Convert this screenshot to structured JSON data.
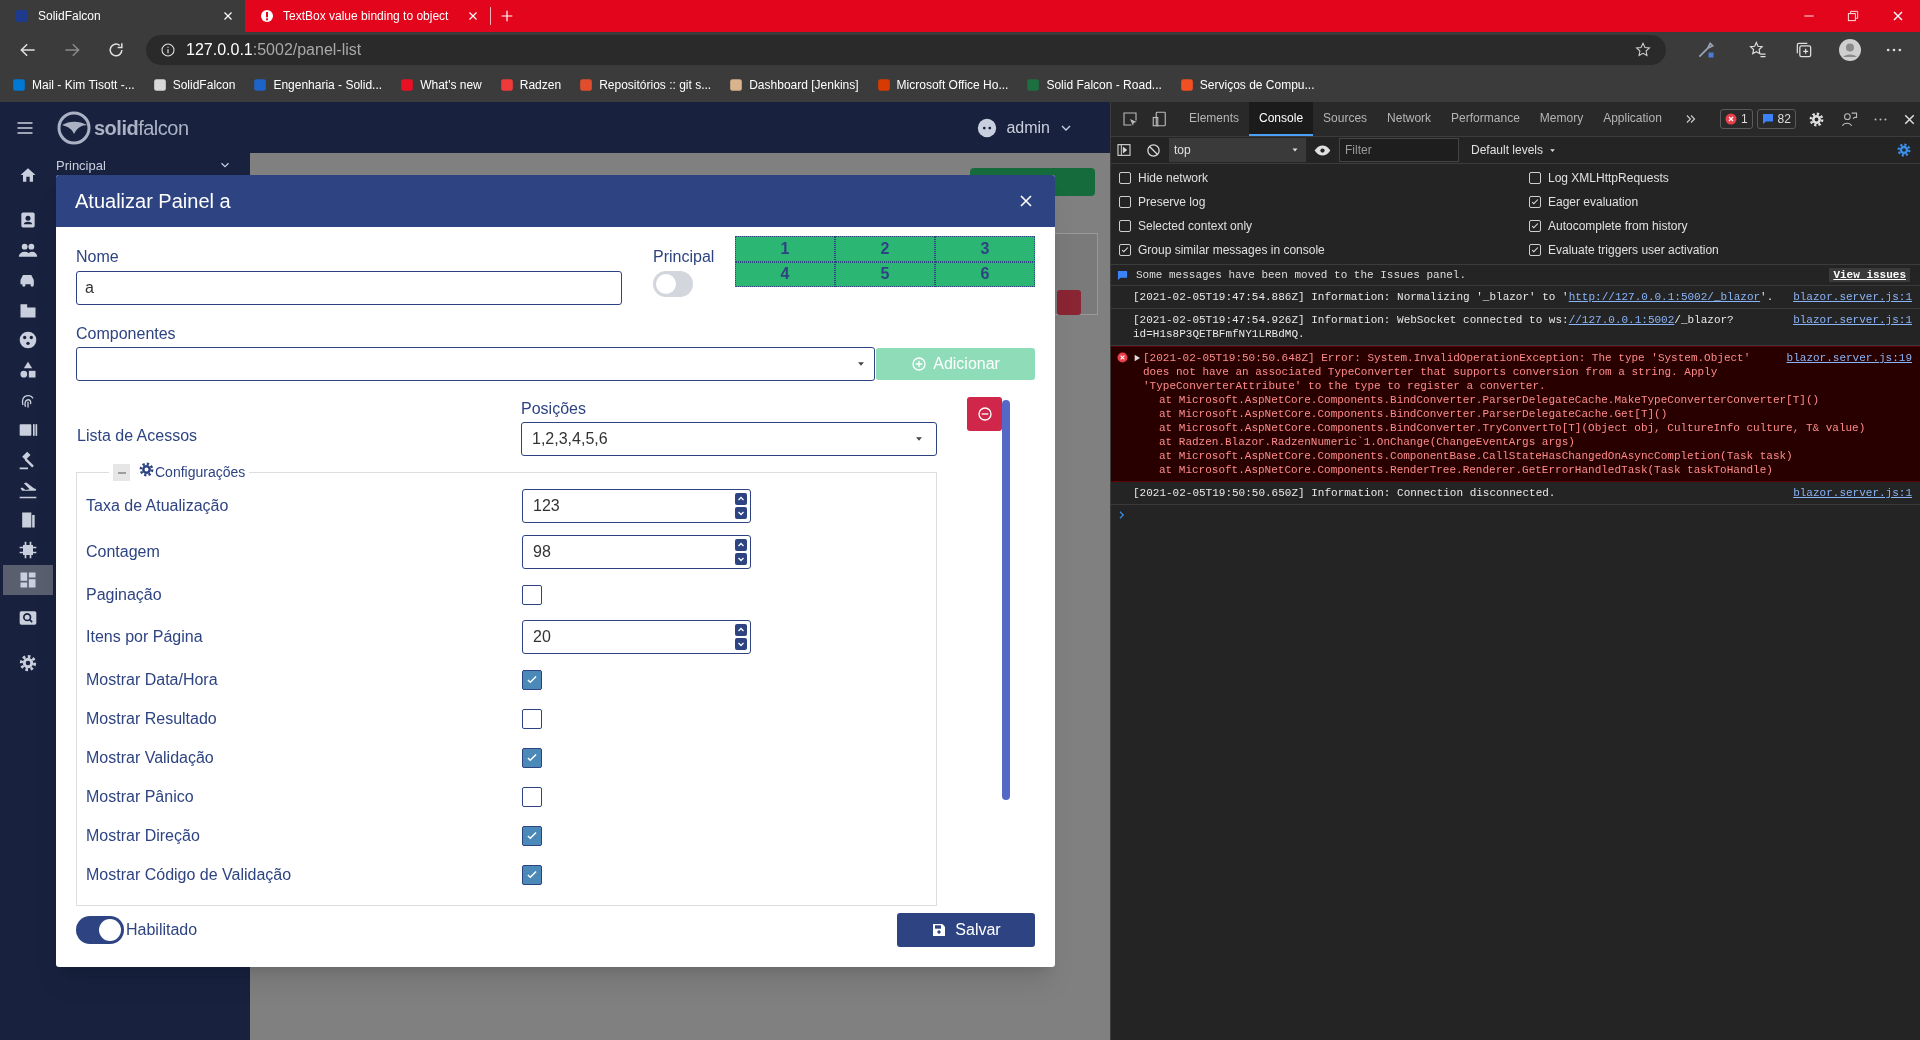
{
  "browser": {
    "tabs": [
      {
        "title": "SolidFalcon",
        "selected": true
      },
      {
        "title": "TextBox value binding to object",
        "selected": false
      }
    ],
    "address": {
      "host": "127.0.0.1",
      "path": ":5002/panel-list"
    },
    "bookmarks": [
      {
        "label": "Mail - Kim Tisott -...",
        "color": "#0078d4"
      },
      {
        "label": "SolidFalcon",
        "color": "#d9d9d9"
      },
      {
        "label": "Engenharia - Solid...",
        "color": "#1e63c7"
      },
      {
        "label": "What's new",
        "color": "#e81123"
      },
      {
        "label": "Radzen",
        "color": "#f03a3a"
      },
      {
        "label": "Repositórios :: git s...",
        "color": "#e04e2d"
      },
      {
        "label": "Dashboard [Jenkins]",
        "color": "#d9b38c"
      },
      {
        "label": "Microsoft Office Ho...",
        "color": "#d83b01"
      },
      {
        "label": "Solid Falcon - Road...",
        "color": "#1d6f42"
      },
      {
        "label": "Serviços de Compu...",
        "color": "#f25022"
      }
    ]
  },
  "app": {
    "brand": "**solid**falcon",
    "user": "admin",
    "sidebar": {
      "section": "Principal",
      "items": [
        {
          "selected": false
        },
        {
          "selected": false
        },
        {
          "selected": false
        },
        {
          "selected": false
        },
        {
          "selected": false
        },
        {
          "selected": false
        },
        {
          "selected": false
        },
        {
          "selected": false
        },
        {
          "selected": false
        },
        {
          "selected": false
        },
        {
          "selected": false
        },
        {
          "selected": false
        },
        {
          "selected": false
        },
        {
          "selected": true
        },
        {
          "selected": false
        },
        {
          "selected": false
        }
      ]
    },
    "modal": {
      "title": "Atualizar Painel a",
      "name": {
        "label": "Nome",
        "value": "a"
      },
      "principal": {
        "label": "Principal",
        "on": false
      },
      "positions_grid": [
        {
          "label": "1"
        },
        {
          "label": "2"
        },
        {
          "label": "3"
        },
        {
          "label": "4"
        },
        {
          "label": "5"
        },
        {
          "label": "6"
        }
      ],
      "components": {
        "label": "Componentes"
      },
      "add_button": {
        "label": "Adicionar",
        "disabled": true
      },
      "access_list": {
        "label": "Lista de Acessos"
      },
      "positions": {
        "label": "Posições",
        "value": "1,2,3,4,5,6"
      },
      "settings": {
        "legend": "Configurações",
        "expanded": true,
        "rows": [
          {
            "kind": "number",
            "label": "Taxa de Atualização",
            "value": "123"
          },
          {
            "kind": "number",
            "label": "Contagem",
            "value": "98"
          },
          {
            "kind": "checkbox",
            "label": "Paginação",
            "checked": false
          },
          {
            "kind": "number",
            "label": "Itens por Página",
            "value": "20"
          },
          {
            "kind": "checkbox",
            "label": "Mostrar Data/Hora",
            "checked": true
          },
          {
            "kind": "checkbox",
            "label": "Mostrar Resultado",
            "checked": false
          },
          {
            "kind": "checkbox",
            "label": "Mostrar Validação",
            "checked": true
          },
          {
            "kind": "checkbox",
            "label": "Mostrar Pânico",
            "checked": false
          },
          {
            "kind": "checkbox",
            "label": "Mostrar Direção",
            "checked": true
          },
          {
            "kind": "checkbox",
            "label": "Mostrar Código de Validação",
            "checked": true
          }
        ]
      },
      "enabled": {
        "label": "Habilitado",
        "on": true
      },
      "save_button": {
        "label": "Salvar"
      }
    }
  },
  "devtools": {
    "tabs": [
      {
        "label": "Elements",
        "selected": false
      },
      {
        "label": "Console",
        "selected": true
      },
      {
        "label": "Sources",
        "selected": false
      },
      {
        "label": "Network",
        "selected": false
      },
      {
        "label": "Performance",
        "selected": false
      },
      {
        "label": "Memory",
        "selected": false
      },
      {
        "label": "Application",
        "selected": false
      }
    ],
    "errors": "1",
    "messages": "82",
    "context": "top",
    "filter_placeholder": "Filter",
    "levels": "Default levels",
    "settings": {
      "left": [
        {
          "label": "Hide network",
          "checked": false
        },
        {
          "label": "Preserve log",
          "checked": false
        },
        {
          "label": "Selected context only",
          "checked": false
        },
        {
          "label": "Group similar messages in console",
          "checked": true
        }
      ],
      "right": [
        {
          "label": "Log XMLHttpRequests",
          "checked": false
        },
        {
          "label": "Eager evaluation",
          "checked": true
        },
        {
          "label": "Autocomplete from history",
          "checked": true
        },
        {
          "label": "Evaluate triggers user activation",
          "checked": true
        }
      ]
    },
    "console": {
      "notice": "Some messages have been moved to the Issues panel.",
      "notice_link": "View issues",
      "entries": [
        {
          "kind": "info",
          "text": "[2021-02-05T19:47:54.886Z] Information: Normalizing '_blazor' to '",
          "link": "http://127.0.0.1:5002/_blazor",
          "text_after": "'.",
          "source": "blazor.server.js:1"
        },
        {
          "kind": "info",
          "text": "[2021-02-05T19:47:54.926Z] Information: WebSocket connected to ws:",
          "link": "//127.0.0.1:5002",
          "text_after": "/_blazor?id=H1s8P3QETBFmfNY1LRBdMQ.",
          "source": "blazor.server.js:1"
        },
        {
          "kind": "error",
          "expanded": false,
          "text": "[2021-02-05T19:50:50.648Z] Error: System.InvalidOperationException: The type 'System.Object' does not have an associated TypeConverter that supports conversion from a string. Apply 'TypeConverterAttribute' to the type to register a converter.",
          "stack": [
            "at Microsoft.AspNetCore.Components.BindConverter.ParserDelegateCache.MakeTypeConverterConverter[T]()",
            "at Microsoft.AspNetCore.Components.BindConverter.ParserDelegateCache.Get[T]()",
            "at Microsoft.AspNetCore.Components.BindConverter.TryConvertTo[T](Object obj, CultureInfo culture, T& value)",
            "at Radzen.Blazor.RadzenNumeric`1.OnChange(ChangeEventArgs args)",
            "at Microsoft.AspNetCore.Components.ComponentBase.CallStateHasChangedOnAsyncCompletion(Task task)",
            "at Microsoft.AspNetCore.Components.RenderTree.Renderer.GetErrorHandledTask(Task taskToHandle)"
          ],
          "source": "blazor.server.js:19"
        },
        {
          "kind": "info",
          "text": "[2021-02-05T19:50:50.650Z] Information: Connection disconnected.",
          "source": "blazor.server.js:1"
        }
      ]
    }
  }
}
